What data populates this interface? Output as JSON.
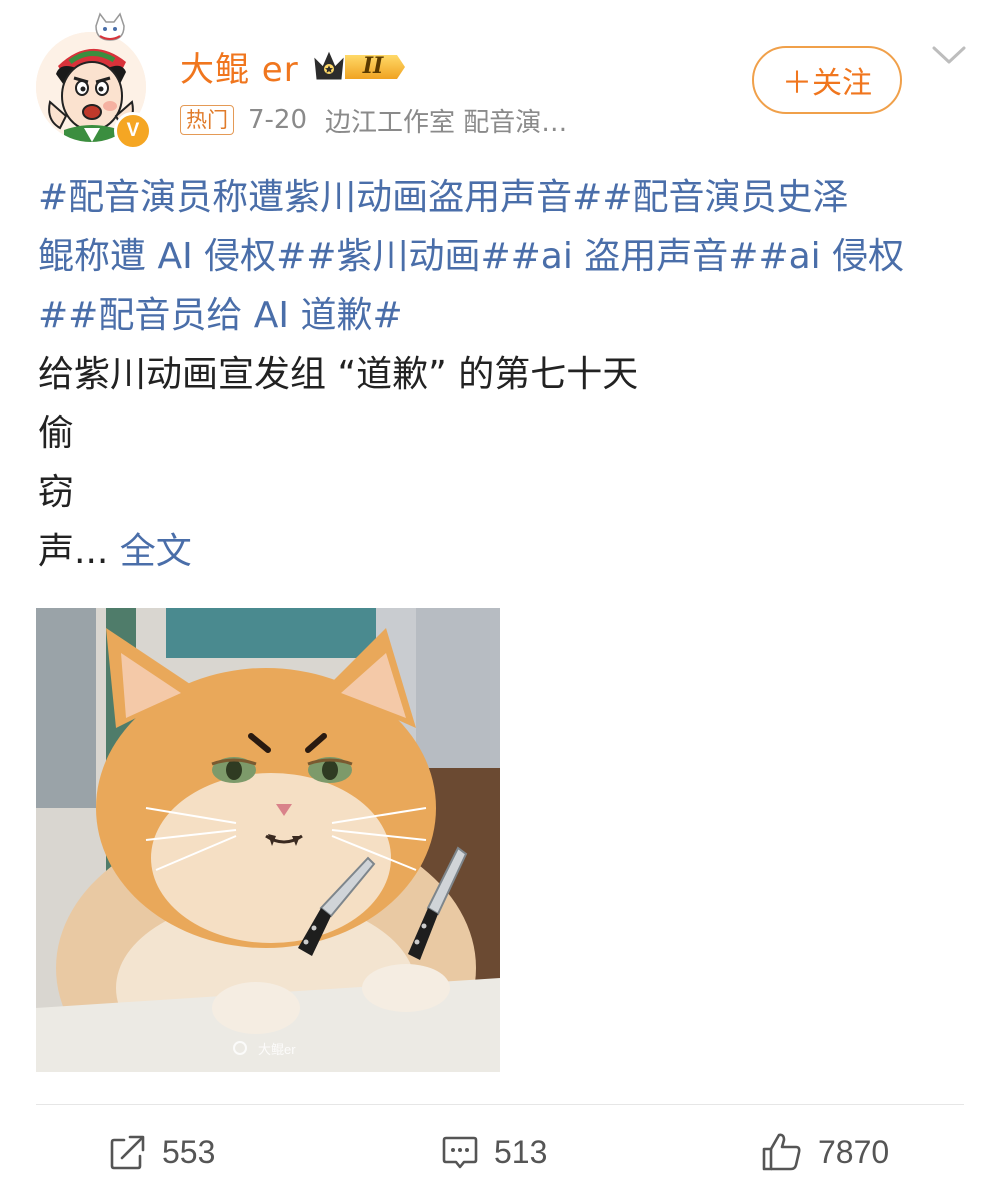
{
  "user": {
    "name": "大鲲 er",
    "level_badge": "II",
    "verified_mark": "V",
    "avatar_icon": "cartoon-avatar-icon"
  },
  "meta": {
    "hot_tag": "热门",
    "date": "7-20",
    "source": "边江工作室 配音演…"
  },
  "follow_button": "＋关注",
  "post": {
    "hashtag_lines": [
      "#配音演员称遭紫川动画盗用声音##配音演员史泽",
      "鲲称遭 AI 侵权##紫川动画##ai 盗用声音##ai 侵权",
      "##配音员给 AI 道歉#"
    ],
    "text_lines": [
      "给紫川动画宣发组 “道歉” 的第七十天",
      "偷",
      "窃"
    ],
    "truncated_line": "声...",
    "full_text_link": "全文"
  },
  "image": {
    "watermark": "大鲲er"
  },
  "actions": {
    "repost_count": "553",
    "comment_count": "513",
    "like_count": "7870"
  },
  "colors": {
    "accent_orange": "#f0761e",
    "link_blue": "#4a6ea9"
  }
}
